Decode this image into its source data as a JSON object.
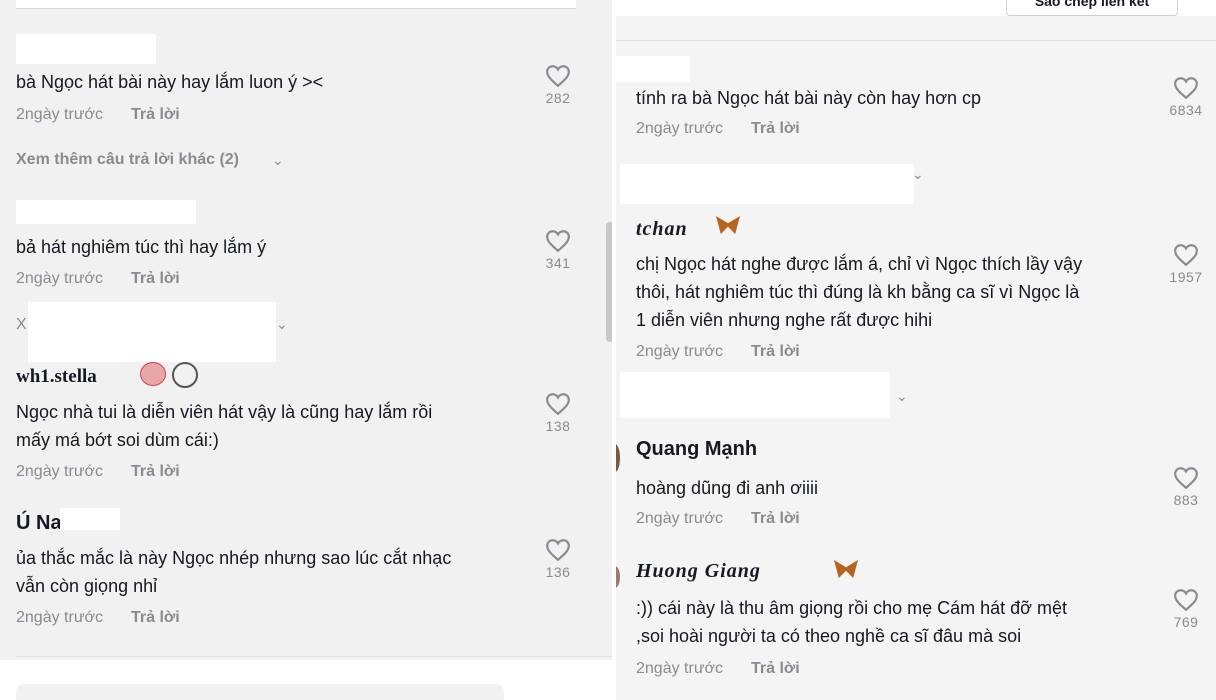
{
  "left": {
    "comments": [
      {
        "text": "bà Ngọc hát bài này hay lắm luon ý ><",
        "time": "2ngày trước",
        "reply": "Trả lời",
        "likes": "282"
      },
      {
        "text": "bả hát nghiêm túc thì hay lắm ý",
        "time": "2ngày trước",
        "reply": "Trả lời",
        "likes": "341"
      },
      {
        "username": "wh1.stella",
        "text_line1": "Ngọc nhà tui là diễn viên hát vậy là cũng hay lắm rồi",
        "text_line2": "mấy má bớt soi dùm cái:)",
        "time": "2ngày trước",
        "reply": "Trả lời",
        "likes": "138"
      },
      {
        "username": "Ú Nam",
        "text_line1": "ủa thắc mắc là này Ngọc nhép nhưng sao lúc cắt nhạc",
        "text_line2": "vẫn còn giọng nhỉ",
        "time": "2ngày trước",
        "reply": "Trả lời",
        "likes": "136"
      }
    ],
    "more_replies": "Xem thêm câu trả lời khác (2)",
    "x_label": "X"
  },
  "right": {
    "top_button": "Sao chép liên kết",
    "comments": [
      {
        "text": "tính ra bà Ngọc hát bài này còn hay hơn cp",
        "time": "2ngày trước",
        "reply": "Trả lời",
        "likes": "6834"
      },
      {
        "username": "tchan",
        "text_line1": "chị Ngọc hát nghe được lắm á, chỉ vì Ngọc thích lầy vậy",
        "text_line2": "thôi, hát nghiêm túc thì đúng là kh bằng ca sĩ vì Ngọc là",
        "text_line3": "1 diễn viên nhưng nghe rất được hihi",
        "time": "2ngày trước",
        "reply": "Trả lời",
        "likes": "1957"
      },
      {
        "username": "Quang Mạnh",
        "text": "hoàng dũng đi anh ơiiii",
        "time": "2ngày trước",
        "reply": "Trả lời",
        "likes": "883"
      },
      {
        "username": "Huong Giang",
        "text_line1": ":)) cái này là thu âm giọng rồi cho mẹ Cám hát đỡ mệt",
        "text_line2": ",soi hoài người ta có theo nghề ca sĩ đâu mà soi",
        "time": "2ngày trước",
        "reply": "Trả lời",
        "likes": "769"
      }
    ]
  },
  "icons": {
    "like": "heart-outline-icon",
    "chevron": "chevron-down-icon"
  },
  "colors": {
    "meta": "#8a8b91",
    "text": "#161823",
    "bg": "#f1f1f2"
  }
}
